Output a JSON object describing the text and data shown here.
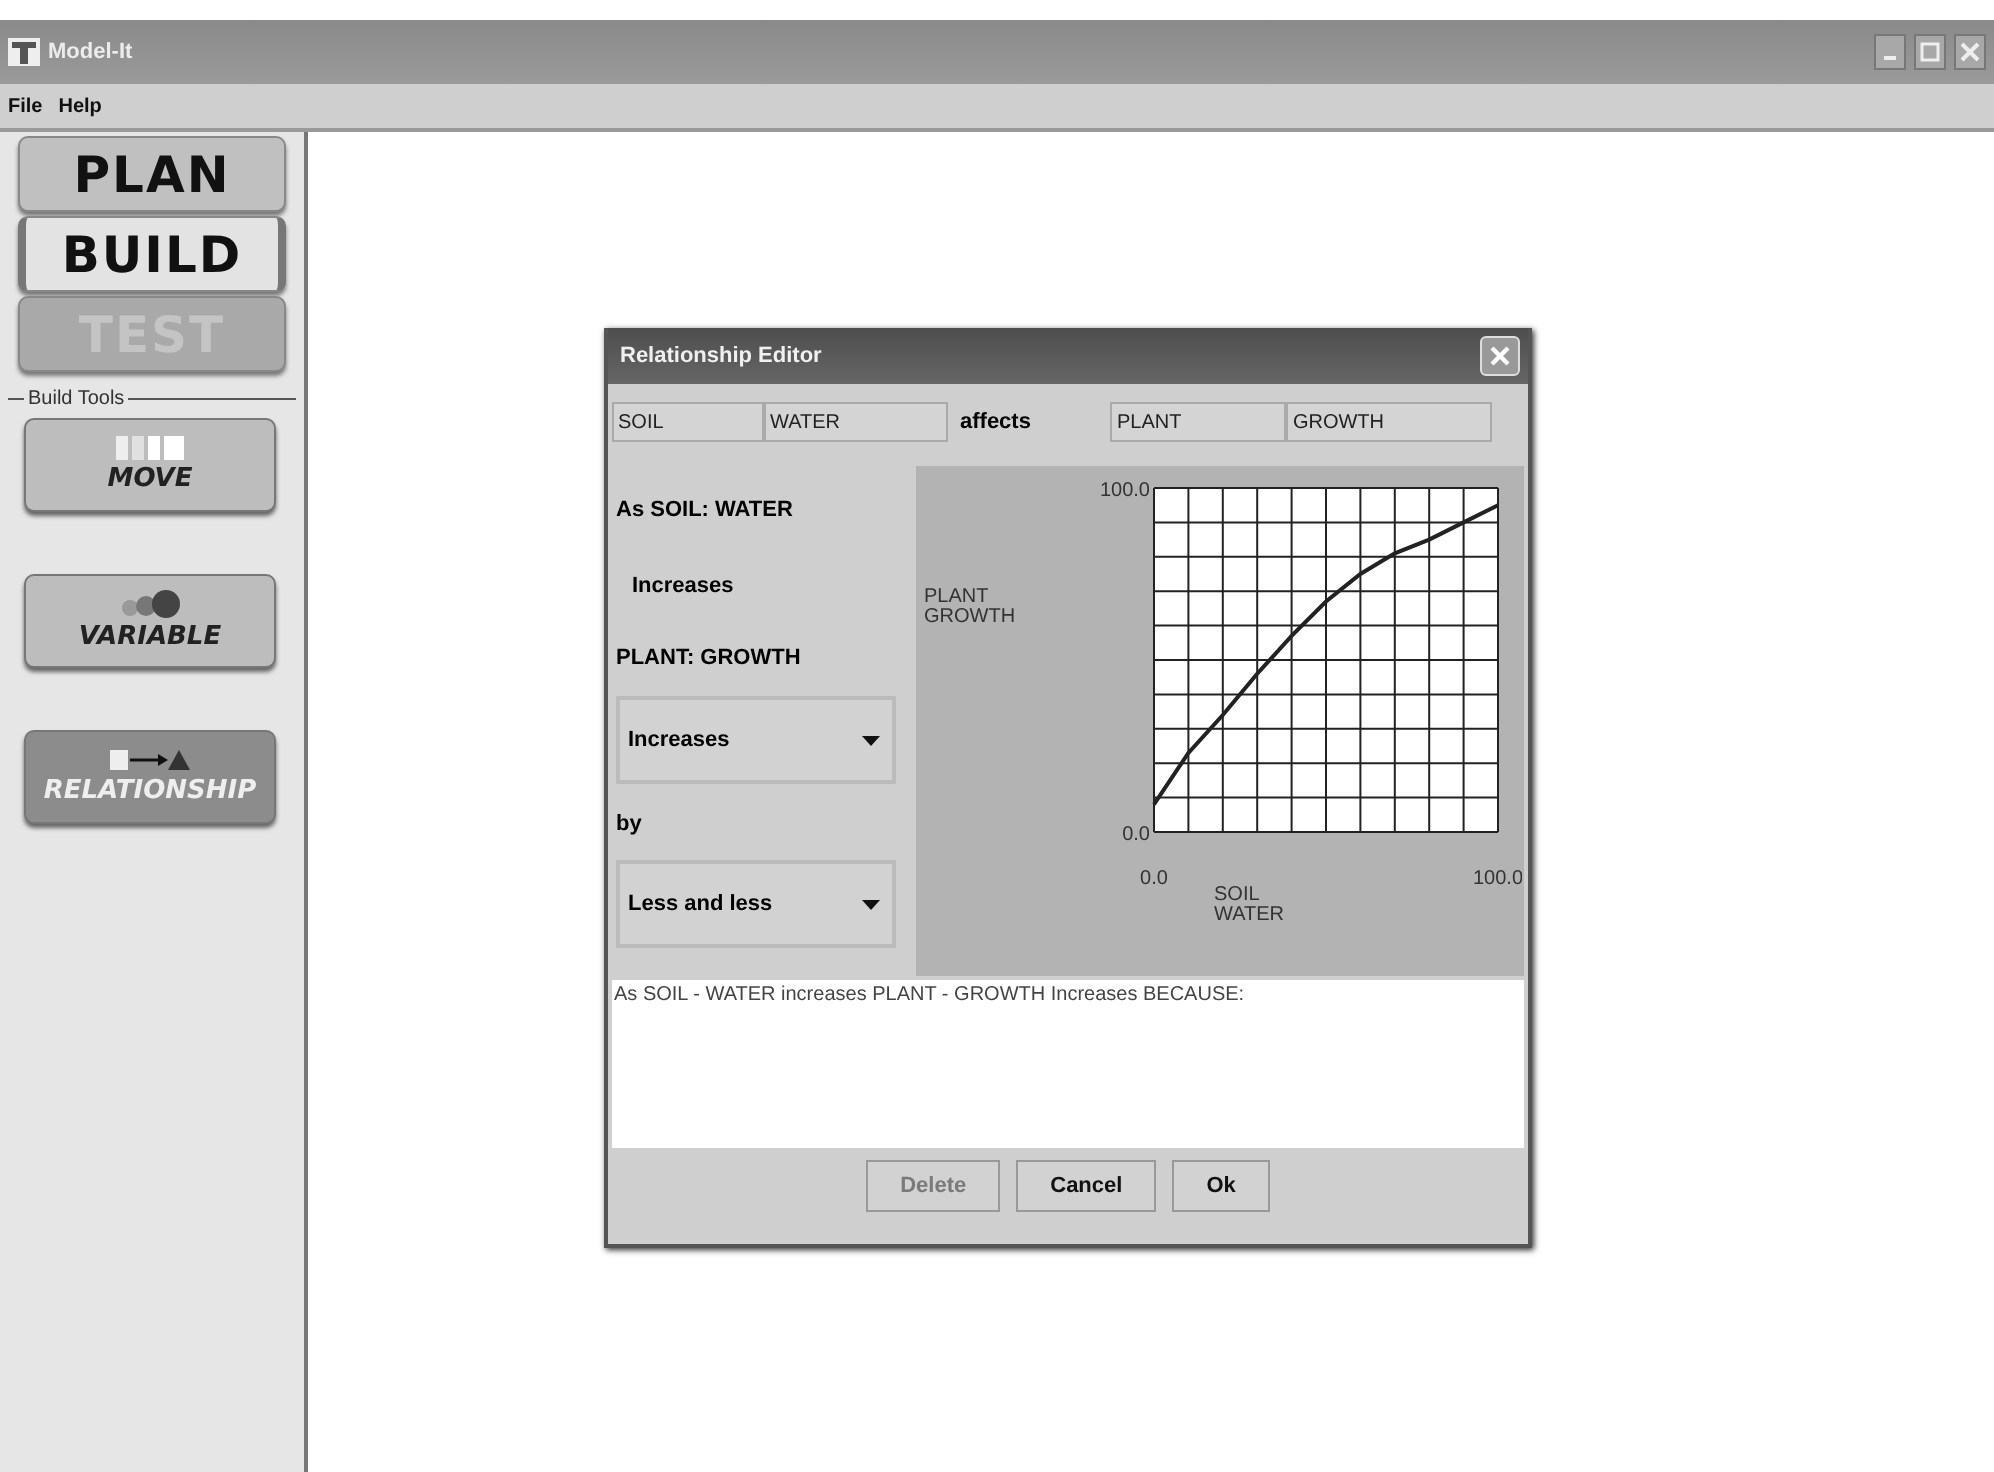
{
  "window": {
    "title": "Model-It"
  },
  "menu": [
    "File",
    "Help"
  ],
  "modes": [
    {
      "label": "PLAN",
      "selected": false,
      "disabled": false
    },
    {
      "label": "BUILD",
      "selected": true,
      "disabled": false
    },
    {
      "label": "TEST",
      "selected": false,
      "disabled": true
    }
  ],
  "build_tools": {
    "title": "Build Tools",
    "tools": [
      {
        "kind": "move",
        "label": "MOVE",
        "selected": false
      },
      {
        "kind": "variable",
        "label": "VARIABLE",
        "selected": false
      },
      {
        "kind": "relationship",
        "label": "RELATIONSHIP",
        "selected": true
      }
    ]
  },
  "dialog": {
    "title": "Relationship Editor",
    "cause": [
      "SOIL",
      "WATER"
    ],
    "verb": "affects",
    "effect": [
      "PLANT",
      "GROWTH"
    ],
    "lines": [
      "As SOIL: WATER",
      "Increases",
      "PLANT: GROWTH"
    ],
    "direction": {
      "value": "Increases"
    },
    "by_label": "by",
    "amount": {
      "value": "Less and less"
    },
    "chart_data": {
      "type": "line",
      "xlabel": "SOIL WATER",
      "ylabel": "PLANT GROWTH",
      "x": [
        0,
        10,
        20,
        30,
        40,
        50,
        60,
        70,
        80,
        90,
        100
      ],
      "series": [
        {
          "color": "#222222",
          "values": [
            8,
            23,
            34,
            46,
            57,
            67,
            75,
            81,
            85,
            90,
            95
          ]
        }
      ],
      "xlim": [
        0,
        100
      ],
      "ylim": [
        0,
        100
      ],
      "xticks": [
        {
          "value": 0,
          "label": "0.0"
        },
        {
          "value": 100,
          "label": "100.0"
        }
      ],
      "yticks": [
        {
          "value": 0,
          "label": "0.0"
        },
        {
          "value": 100,
          "label": "100.0"
        }
      ]
    },
    "explanation": "As SOIL - WATER increases PLANT - GROWTH Increases BECAUSE:",
    "buttons": [
      {
        "label": "Delete",
        "disabled": true
      },
      {
        "label": "Cancel",
        "disabled": false
      },
      {
        "label": "Ok",
        "disabled": false
      }
    ]
  }
}
